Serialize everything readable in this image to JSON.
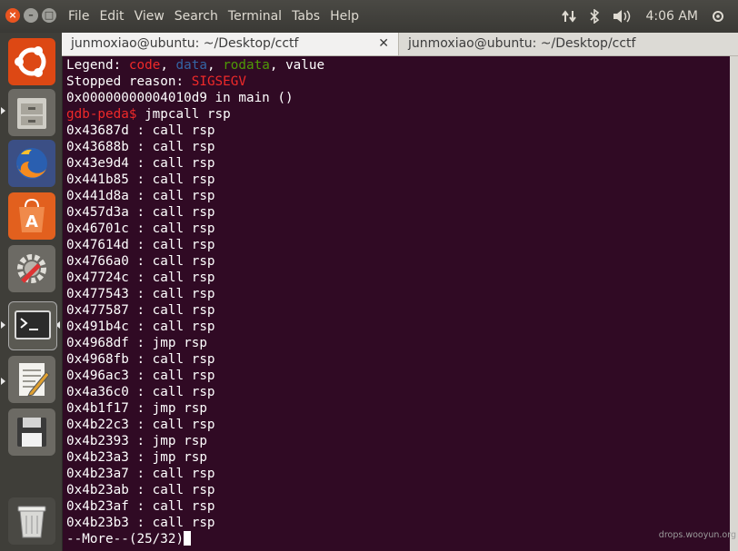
{
  "menu_bar": {
    "items": [
      "File",
      "Edit",
      "View",
      "Search",
      "Terminal",
      "Tabs",
      "Help"
    ],
    "clock": "4:06 AM"
  },
  "tabs": [
    {
      "title": "junmoxiao@ubuntu: ~/Desktop/cctf",
      "close": "✕"
    },
    {
      "title": "junmoxiao@ubuntu: ~/Desktop/cctf"
    }
  ],
  "launcher": {
    "icons": [
      "ubuntu-dash-icon",
      "files-icon",
      "firefox-icon",
      "software-center-icon",
      "system-settings-icon",
      "terminal-icon",
      "text-editor-icon",
      "save-disk-icon",
      "trash-icon"
    ]
  },
  "terminal": {
    "legend_label": "Legend: ",
    "legend_code": "code",
    "legend_data": "data",
    "legend_rodata": "rodata",
    "legend_value": "value",
    "legend_sep": ", ",
    "stopped_label": "Stopped reason: ",
    "stopped_reason": "SIGSEGV",
    "frame": "0x00000000004010d9 in main ()",
    "prompt": "gdb-peda$",
    "command": " jmpcall rsp",
    "results": [
      "0x43687d : call rsp",
      "0x43688b : call rsp",
      "0x43e9d4 : call rsp",
      "0x441b85 : call rsp",
      "0x441d8a : call rsp",
      "0x457d3a : call rsp",
      "0x46701c : call rsp",
      "0x47614d : call rsp",
      "0x4766a0 : call rsp",
      "0x47724c : call rsp",
      "0x477543 : call rsp",
      "0x477587 : call rsp",
      "0x491b4c : call rsp",
      "0x4968df : jmp rsp",
      "0x4968fb : call rsp",
      "0x496ac3 : call rsp",
      "0x4a36c0 : call rsp",
      "0x4b1f17 : jmp rsp",
      "0x4b22c3 : call rsp",
      "0x4b2393 : jmp rsp",
      "0x4b23a3 : jmp rsp",
      "0x4b23a7 : call rsp",
      "0x4b23ab : call rsp",
      "0x4b23af : call rsp",
      "0x4b23b3 : call rsp"
    ],
    "more": "--More--(25/32)"
  },
  "watermark": "drops.wooyun.org",
  "colors": {
    "terminal_bg": "#300a24",
    "code": "#ef2929",
    "data": "#3465a4",
    "rodata": "#4e9a06",
    "ubuntu_orange": "#e95420"
  }
}
